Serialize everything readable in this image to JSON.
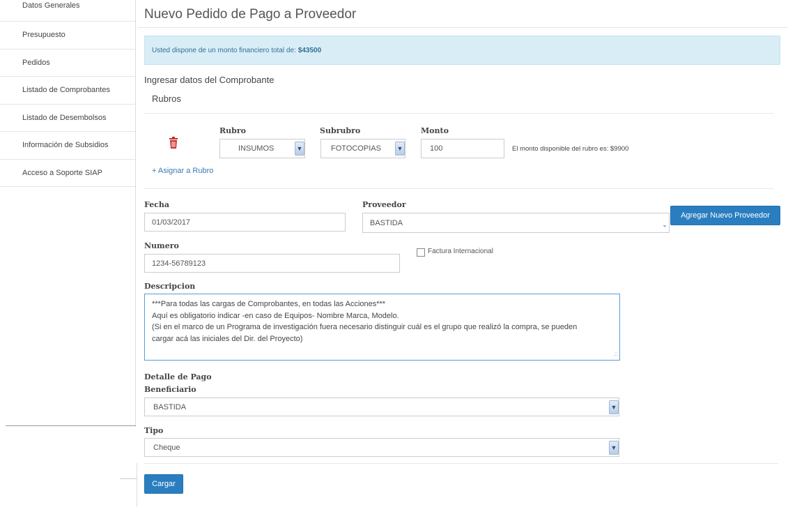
{
  "sidebar": {
    "items": [
      {
        "label": "Datos Generales"
      },
      {
        "label": "Presupuesto"
      },
      {
        "label": "Pedidos"
      },
      {
        "label": "Listado de Comprobantes"
      },
      {
        "label": "Listado de Desembolsos"
      },
      {
        "label": "Información de Subsidios"
      },
      {
        "label": "Acceso a Soporte SIAP"
      }
    ]
  },
  "main": {
    "title": "Nuevo Pedido de Pago a Proveedor",
    "alert": {
      "text": "Usted dispone de un monto financiero total de:",
      "amount": "$43500"
    },
    "section_comprobante": "Ingresar datos del Comprobante",
    "section_rubros": "Rubros",
    "rubro_row": {
      "rubro_label": "Rubro",
      "subrubro_label": "Subrubro",
      "monto_label": "Monto",
      "rubro_value": "INSUMOS",
      "subrubro_value": "FOTOCOPIAS",
      "monto_value": "100",
      "hint": "El monto disponible del rubro es: $9900"
    },
    "assign_link": "+ Asignar a Rubro",
    "fecha_label": "Fecha",
    "fecha_value": "01/03/2017",
    "proveedor_label": "Proveedor",
    "proveedor_value": "BASTIDA",
    "add_proveedor_button": "Agregar Nuevo Proveedor",
    "numero_label": "Numero",
    "numero_value": "1234-56789123",
    "factura_internacional_label": "Factura Internacional",
    "descripcion_label": "Descripcion",
    "descripcion_lines": [
      "***Para todas las cargas de Comprobantes, en todas las Acciones***",
      "Aquí es obligatorio indicar -en caso de Equipos- Nombre Marca, Modelo.",
      "(Si en el marco de un Programa de investigación fuera necesario distinguir cuál es el grupo que realizó la compra, se pueden",
      "cargar acá las iniciales del Dir. del Proyecto)"
    ],
    "detalle_pago_label": "Detalle de Pago",
    "beneficiario_label": "Beneficiario",
    "beneficiario_value": "BASTIDA",
    "tipo_label": "Tipo",
    "tipo_value": "Cheque",
    "submit_button": "Cargar"
  },
  "colors": {
    "accent": "#2a7ec0",
    "alert_bg": "#d9edf7",
    "trash": "#c9302c"
  }
}
